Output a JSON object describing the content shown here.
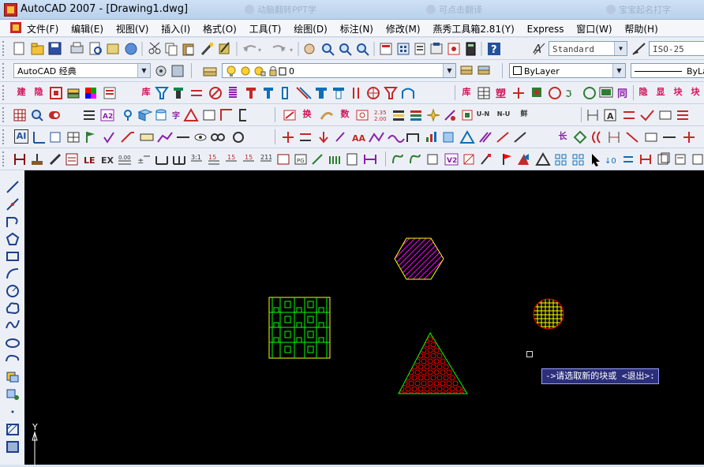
{
  "window": {
    "title": "AutoCAD 2007 - [Drawing1.dwg]",
    "ghost_tabs": [
      "动脑翻转PPT学",
      "可点击翻译",
      "宝宝起名打字"
    ]
  },
  "menubar": {
    "items": [
      "文件(F)",
      "编辑(E)",
      "视图(V)",
      "插入(I)",
      "格式(O)",
      "工具(T)",
      "绘图(D)",
      "标注(N)",
      "修改(M)",
      "燕秀工具箱2.81(Y)",
      "Express",
      "窗口(W)",
      "帮助(H)"
    ]
  },
  "standard_toolbar": {
    "text_style": "Standard",
    "dim_style": "ISO-25"
  },
  "workspace_toolbar": {
    "workspace": "AutoCAD 经典",
    "layer": "0",
    "color": "ByLayer",
    "linetype": "ByLa"
  },
  "yanxiu_row1": [
    "建",
    "隐",
    "库",
    "库",
    "隐",
    "显",
    "块",
    "块"
  ],
  "yanxiu_row2": [
    "换",
    "数",
    "U-N",
    "N-U",
    "鲜",
    "A2"
  ],
  "yanxiu_row3": [
    "AI",
    "长"
  ],
  "canvas": {
    "ucs_label": "Y",
    "command_prompt": "->请选取新的块或 <退出>:"
  },
  "colors": {
    "canvas_bg": "#000000",
    "yellow": "#ffff00",
    "green": "#00ff00",
    "magenta": "#ff00ff",
    "red": "#ff0000",
    "prompt_bg": "#2b2f7a"
  }
}
